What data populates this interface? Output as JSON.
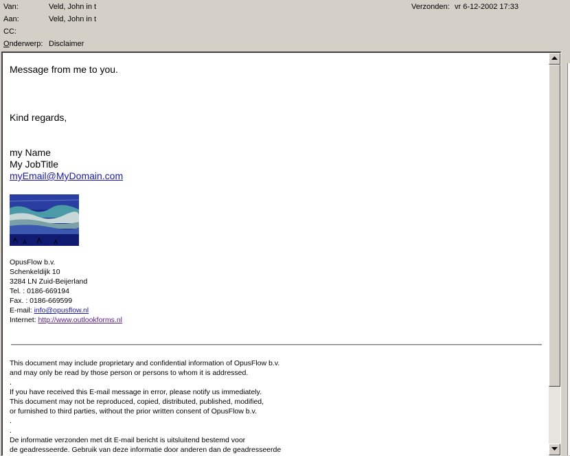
{
  "header": {
    "from_label": "Van:",
    "from_value": "Veld, John in t",
    "to_label": "Aan:",
    "to_value": "Veld, John in t",
    "cc_label": "CC:",
    "cc_value": "",
    "subject_label_first": "O",
    "subject_label_rest": "nderwerp:",
    "subject_value": "Disclaimer",
    "sent_label": "Verzonden:",
    "sent_value": "vr 6-12-2002 17:33"
  },
  "body": {
    "greeting": "Message from me to you.",
    "closing": "Kind regards,",
    "name": "my Name",
    "job_title": "My JobTitle",
    "email_link": "myEmail@MyDomain.com",
    "company": "OpusFlow b.v.",
    "street": "Schenkeldijk 10",
    "city": "3284 LN Zuid-Beijerland",
    "tel": "Tel. : 0186-669194",
    "fax": "Fax. : 0186-669599",
    "email_label": "E-mail:",
    "email_value": "info@opusflow.nl",
    "internet_label": "Internet:",
    "internet_value": "http://www.outlookforms.nl",
    "disclaimer": [
      "This document may include proprietary and confidential information of OpusFlow b.v.",
      "and may only be read by those person or persons to whom it is addressed.",
      ".",
      "If you have received this E-mail message in error, please notify us immediately.",
      "This document may not be reproduced, copied, distributed, published, modified,",
      "or furnished to third parties, without the prior written consent of OpusFlow b.v.",
      ".",
      ".",
      "De informatie verzonden met dit E-mail bericht is uitsluitend bestemd voor",
      "de geadresseerde. Gebruik van deze informatie door anderen dan de geadresseerde"
    ]
  },
  "icons": {
    "scroll_up": "triangle-up",
    "scroll_down": "triangle-down",
    "logo": "opusflow-logo-image"
  }
}
